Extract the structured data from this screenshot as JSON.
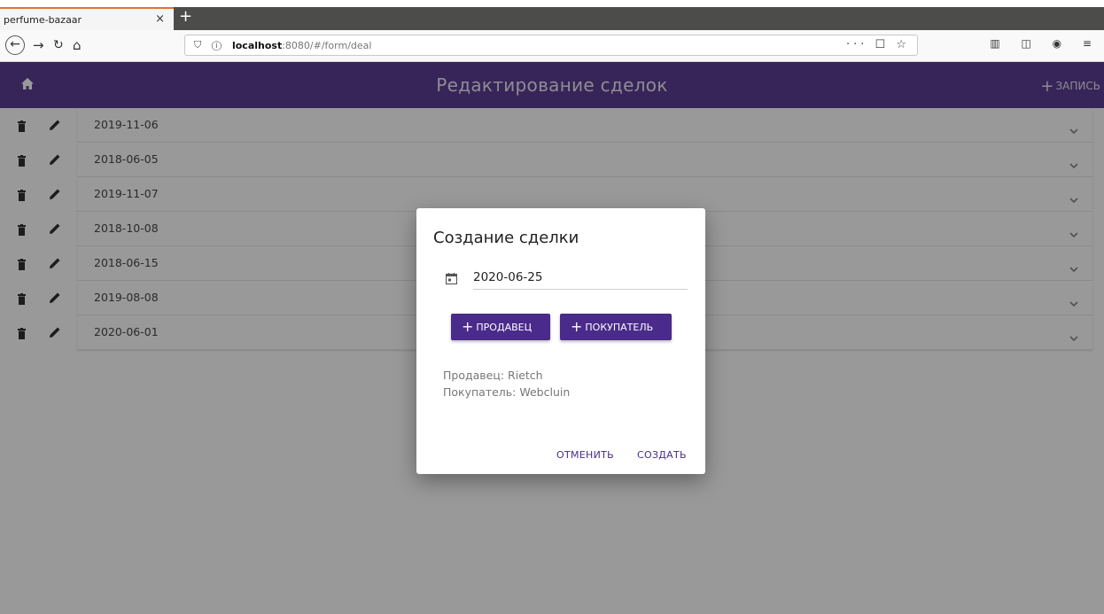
{
  "browser": {
    "tab_title": "perfume-bazaar",
    "tab_close": "×",
    "new_tab": "+",
    "url_host": "localhost",
    "url_path": ":8080/#/form/deal",
    "url_actions": "··· ☐ ☆"
  },
  "app": {
    "title": "Редактирование сделок",
    "add_record_label": "ЗАПИСЬ"
  },
  "deals": [
    {
      "date": "2019-11-06"
    },
    {
      "date": "2018-06-05"
    },
    {
      "date": "2019-11-07"
    },
    {
      "date": "2018-10-08"
    },
    {
      "date": "2018-06-15"
    },
    {
      "date": "2019-08-08"
    },
    {
      "date": "2020-06-01"
    }
  ],
  "dialog": {
    "title": "Создание сделки",
    "date_value": "2020-06-25",
    "add_seller_label": "ПРОДАВЕЦ",
    "add_buyer_label": "ПОКУПАТЕЛЬ",
    "seller_info": "Продавец: Rietch",
    "buyer_info": "Покупатель: Webcluin",
    "cancel_label": "ОТМЕНИТЬ",
    "create_label": "СОЗДАТЬ"
  },
  "colors": {
    "primary": "#4a2a8a",
    "overlay": "#212121"
  }
}
